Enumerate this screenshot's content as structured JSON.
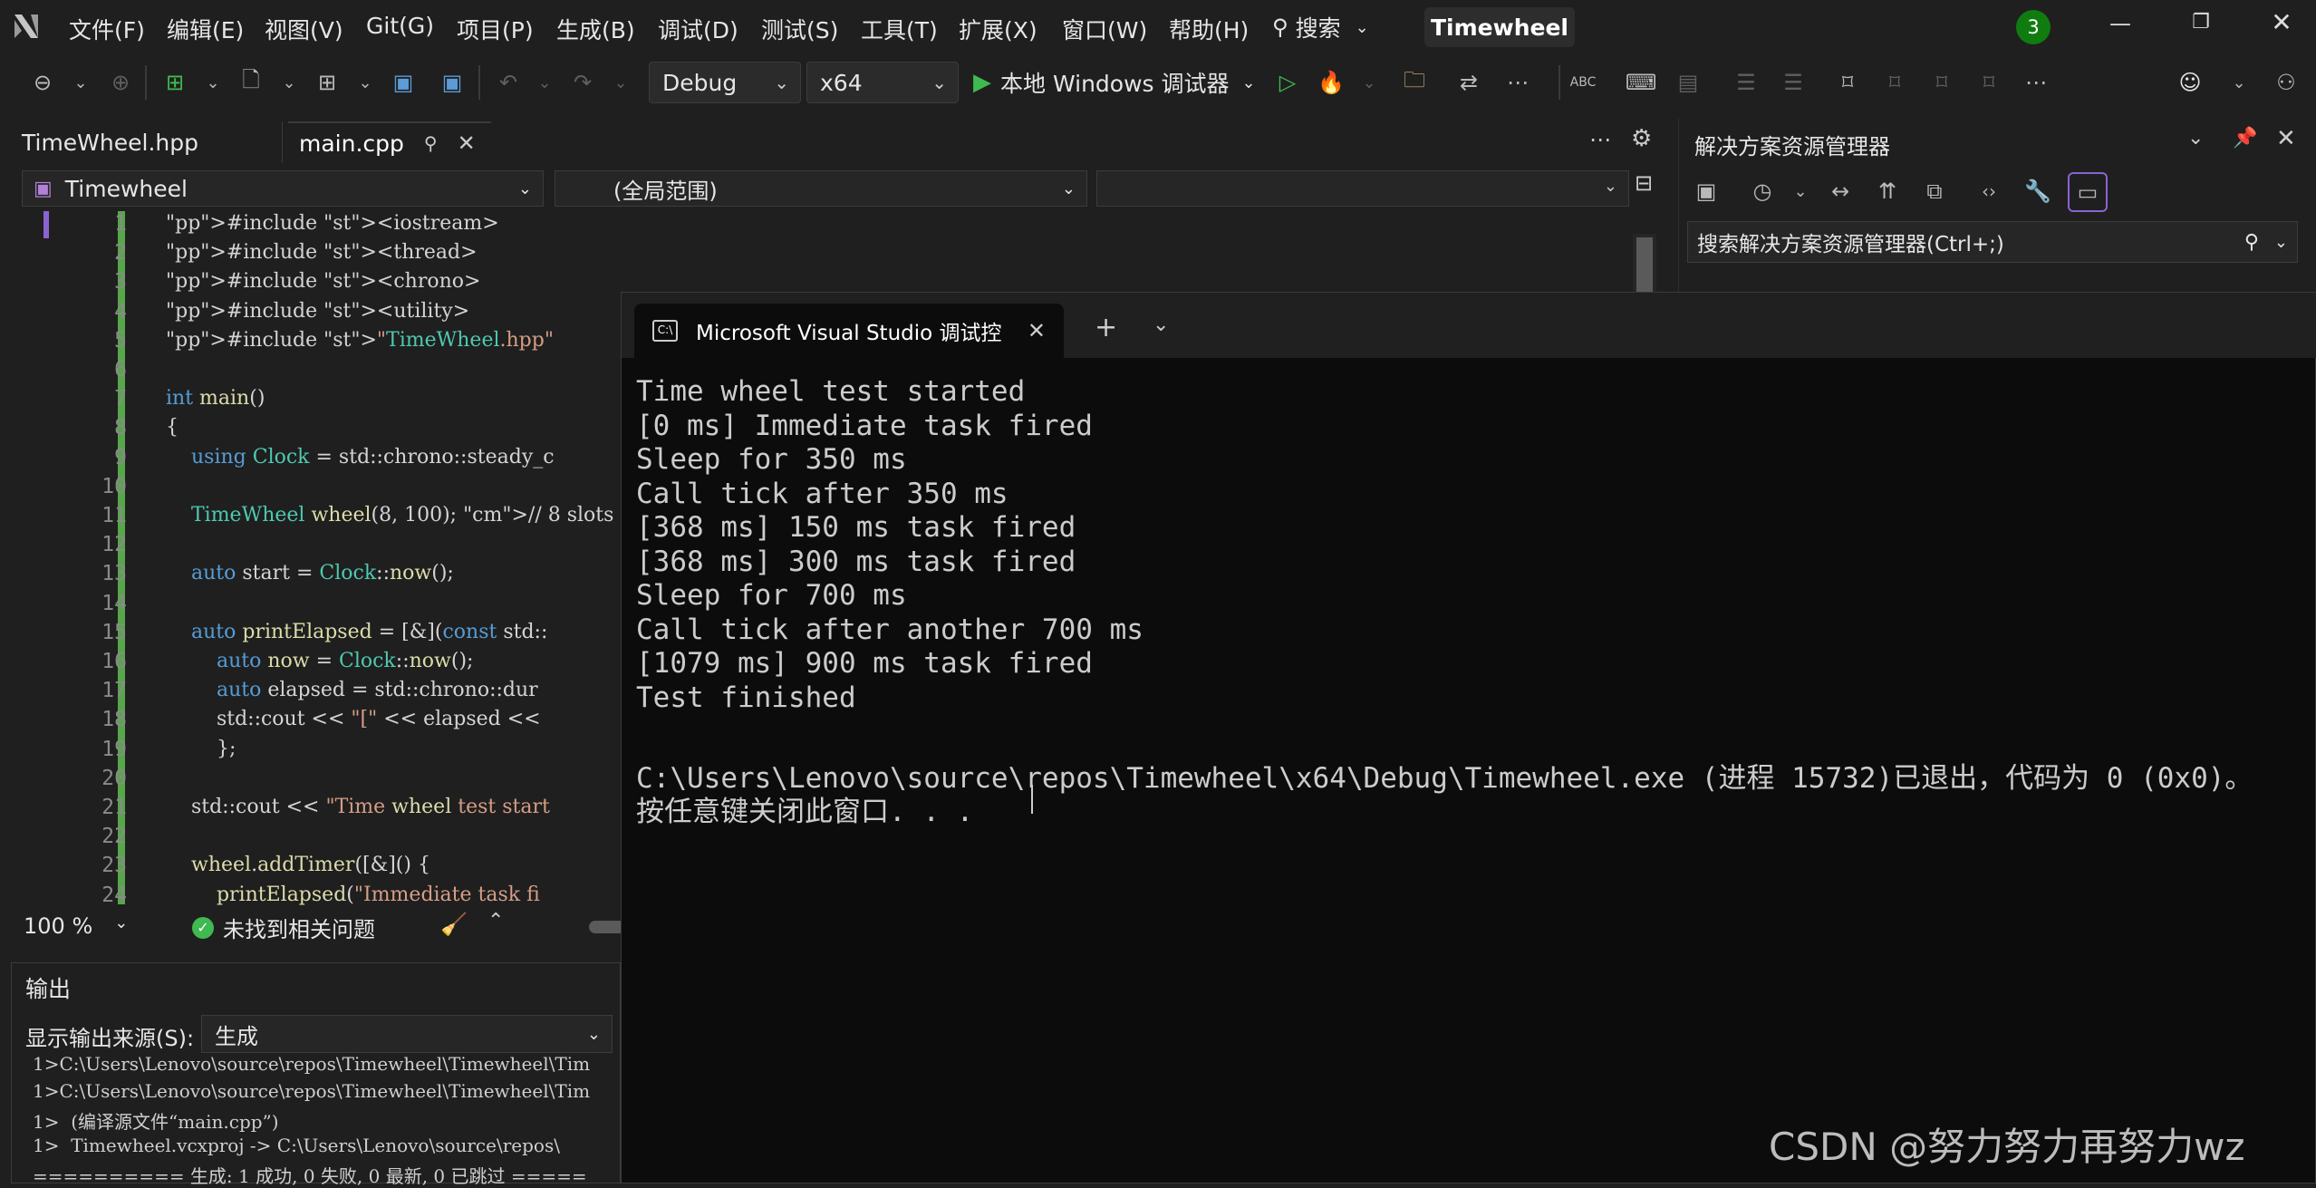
{
  "menu": {
    "items": [
      "文件(F)",
      "编辑(E)",
      "视图(V)",
      "Git(G)",
      "项目(P)",
      "生成(B)",
      "调试(D)",
      "测试(S)",
      "工具(T)",
      "扩展(X)",
      "窗口(W)",
      "帮助(H)"
    ],
    "search_label": "搜索",
    "solution_title": "Timewheel",
    "notification_count": "3"
  },
  "toolbar": {
    "config": "Debug",
    "platform": "x64",
    "run_label": "本地 Windows 调试器"
  },
  "tabs": {
    "tab1": "TimeWheel.hpp",
    "tab2": "main.cpp"
  },
  "navbar": {
    "project": "Timewheel",
    "scope": "(全局范围)"
  },
  "code": {
    "lines": [
      "#include <iostream>",
      "#include <thread>",
      "#include <chrono>",
      "#include <utility>",
      "#include \"TimeWheel.hpp\"",
      "",
      "int main()",
      "{",
      "    using Clock = std::chrono::steady_c",
      "",
      "    TimeWheel wheel(8, 100); // 8 slots",
      "",
      "    auto start = Clock::now();",
      "",
      "    auto printElapsed = [&](const std::",
      "        auto now = Clock::now();",
      "        auto elapsed = std::chrono::dur",
      "        std::cout << \"[\" << elapsed <<",
      "        };",
      "",
      "    std::cout << \"Time wheel test start",
      "",
      "    wheel.addTimer([&]() {",
      "        printElapsed(\"Immediate task fi"
    ]
  },
  "statusbar": {
    "zoom": "100 %",
    "issues": "未找到相关问题"
  },
  "output_panel": {
    "title": "输出",
    "source_label": "显示输出来源(S):",
    "source_value": "生成",
    "lines": [
      "1>C:\\Users\\Lenovo\\source\\repos\\Timewheel\\Timewheel\\Tim",
      "1>C:\\Users\\Lenovo\\source\\repos\\Timewheel\\Timewheel\\Tim",
      "1>  (编译源文件“main.cpp”)",
      "1>  Timewheel.vcxproj -> C:\\Users\\Lenovo\\source\\repos\\",
      "========== 生成: 1 成功, 0 失败, 0 最新, 0 已跳过 ====="
    ]
  },
  "solution_explorer": {
    "title": "解决方案资源管理器",
    "search_placeholder": "搜索解决方案资源管理器(Ctrl+;)"
  },
  "console": {
    "tab_title": "Microsoft Visual Studio 调试控",
    "lines": [
      "Time wheel test started",
      "[0 ms] Immediate task fired",
      "Sleep for 350 ms",
      "Call tick after 350 ms",
      "[368 ms] 150 ms task fired",
      "[368 ms] 300 ms task fired",
      "Sleep for 700 ms",
      "Call tick after another 700 ms",
      "[1079 ms] 900 ms task fired",
      "Test finished",
      "",
      "C:\\Users\\Lenovo\\source\\repos\\Timewheel\\x64\\Debug\\Timewheel.exe (进程 15732)已退出，代码为 0 (0x0)。",
      "按任意键关闭此窗口. . ."
    ]
  },
  "watermark": "CSDN @努力努力再努力wz",
  "colors": {
    "accent": "#8a63d2",
    "run_green": "#3fb950",
    "badge_green": "#107c10",
    "background": "#1f1f1f",
    "console_bg": "#0c0c0c"
  }
}
